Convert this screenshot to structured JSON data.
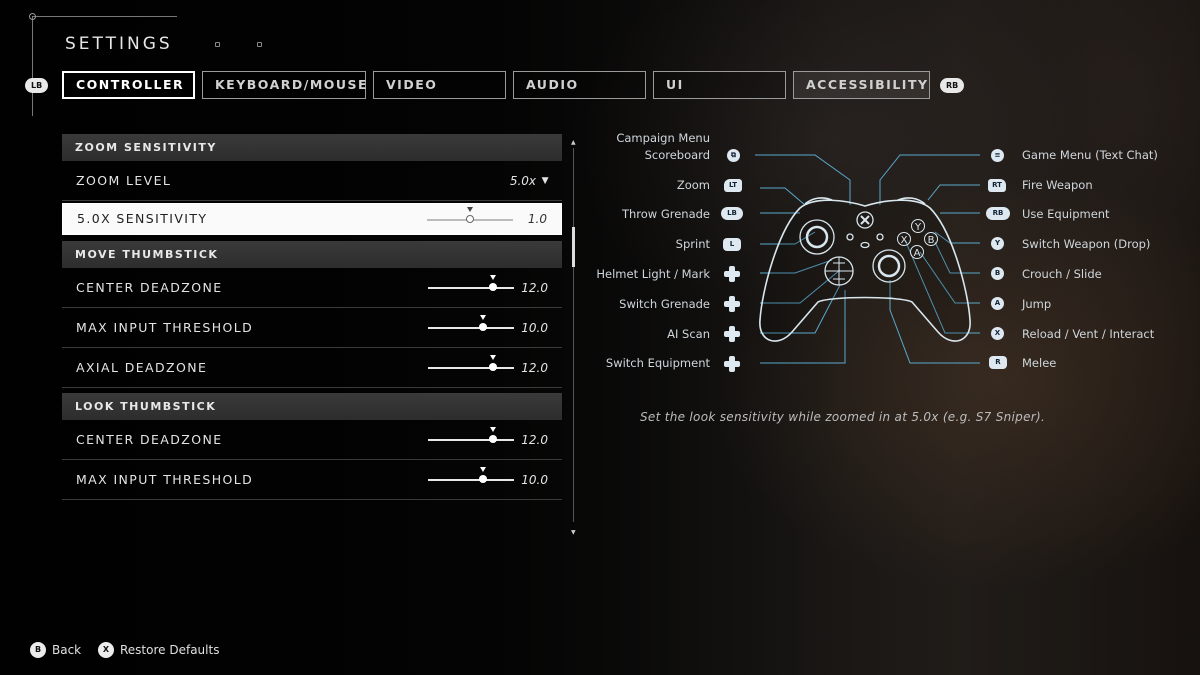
{
  "header": {
    "title": "SETTINGS"
  },
  "bumpers": {
    "left": "LB",
    "right": "RB"
  },
  "tabs": [
    {
      "label": "CONTROLLER",
      "active": true
    },
    {
      "label": "KEYBOARD/MOUSE",
      "active": false
    },
    {
      "label": "VIDEO",
      "active": false
    },
    {
      "label": "AUDIO",
      "active": false
    },
    {
      "label": "UI",
      "active": false
    },
    {
      "label": "ACCESSIBILITY",
      "active": false
    }
  ],
  "settings": {
    "zoom_section": "ZOOM SENSITIVITY",
    "zoom_level": {
      "label": "ZOOM LEVEL",
      "value": "5.0x"
    },
    "zoom_sensitivity": {
      "label": "5.0X SENSITIVITY",
      "value": "1.0",
      "level": 0.5
    },
    "move_section": "MOVE THUMBSTICK",
    "move_center_deadzone": {
      "label": "CENTER DEADZONE",
      "value": "12.0",
      "level": 0.76
    },
    "move_max_input": {
      "label": "MAX INPUT THRESHOLD",
      "value": "10.0",
      "level": 0.64
    },
    "move_axial_deadzone": {
      "label": "AXIAL DEADZONE",
      "value": "12.0",
      "level": 0.76
    },
    "look_section": "LOOK THUMBSTICK",
    "look_center_deadzone": {
      "label": "CENTER DEADZONE",
      "value": "12.0",
      "level": 0.76
    },
    "look_max_input": {
      "label": "MAX INPUT THRESHOLD",
      "value": "10.0",
      "level": 0.64
    }
  },
  "controller_map": {
    "left": [
      {
        "label": "Campaign Menu",
        "icon": "view-button"
      },
      {
        "label": "Scoreboard",
        "icon": "view-button"
      },
      {
        "label": "Zoom",
        "icon": "LT"
      },
      {
        "label": "Throw Grenade",
        "icon": "LB"
      },
      {
        "label": "Sprint",
        "icon": "L"
      },
      {
        "label": "Helmet Light / Mark",
        "icon": "dpad-up"
      },
      {
        "label": "Switch Grenade",
        "icon": "dpad-right"
      },
      {
        "label": "AI Scan",
        "icon": "dpad-down"
      },
      {
        "label": "Switch Equipment",
        "icon": "dpad-left"
      }
    ],
    "right": [
      {
        "label": "Game Menu (Text Chat)",
        "icon": "menu-button"
      },
      {
        "label": "Fire Weapon",
        "icon": "RT"
      },
      {
        "label": "Use Equipment",
        "icon": "RB"
      },
      {
        "label": "Switch Weapon (Drop)",
        "icon": "Y"
      },
      {
        "label": "Crouch / Slide",
        "icon": "B"
      },
      {
        "label": "Jump",
        "icon": "A"
      },
      {
        "label": "Reload / Vent / Interact",
        "icon": "X"
      },
      {
        "label": "Melee",
        "icon": "R"
      }
    ],
    "face_buttons": {
      "y": "Y",
      "x": "X",
      "b": "B",
      "a": "A"
    }
  },
  "description": "Set the look sensitivity while zoomed in at 5.0x (e.g. S7 Sniper).",
  "footer": {
    "back": {
      "button": "B",
      "label": "Back"
    },
    "restore": {
      "button": "X",
      "label": "Restore Defaults"
    }
  },
  "colors": {
    "accent": "#7fc4e0",
    "line": "#5aa9cc"
  }
}
